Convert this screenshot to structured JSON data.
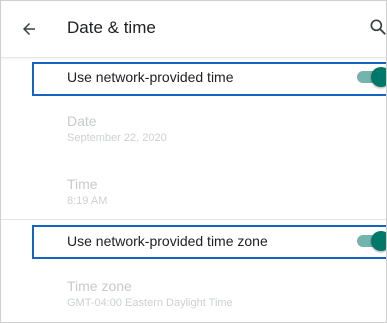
{
  "header": {
    "title": "Date & time",
    "back_icon": "arrow-back-icon",
    "search_icon": "search-icon"
  },
  "settings": {
    "network_time": {
      "title": "Use network-provided time",
      "toggle_on": true
    },
    "date": {
      "title": "Date",
      "value": "September 22, 2020"
    },
    "time": {
      "title": "Time",
      "value": "8:19 AM"
    },
    "network_timezone": {
      "title": "Use network-provided time zone",
      "toggle_on": true
    },
    "timezone": {
      "title": "Time zone",
      "value": "GMT-04:00 Eastern Daylight Time"
    }
  },
  "colors": {
    "accent": "#00796b",
    "highlight_border": "#1565c0",
    "disabled_text": "#c7c9cc"
  }
}
